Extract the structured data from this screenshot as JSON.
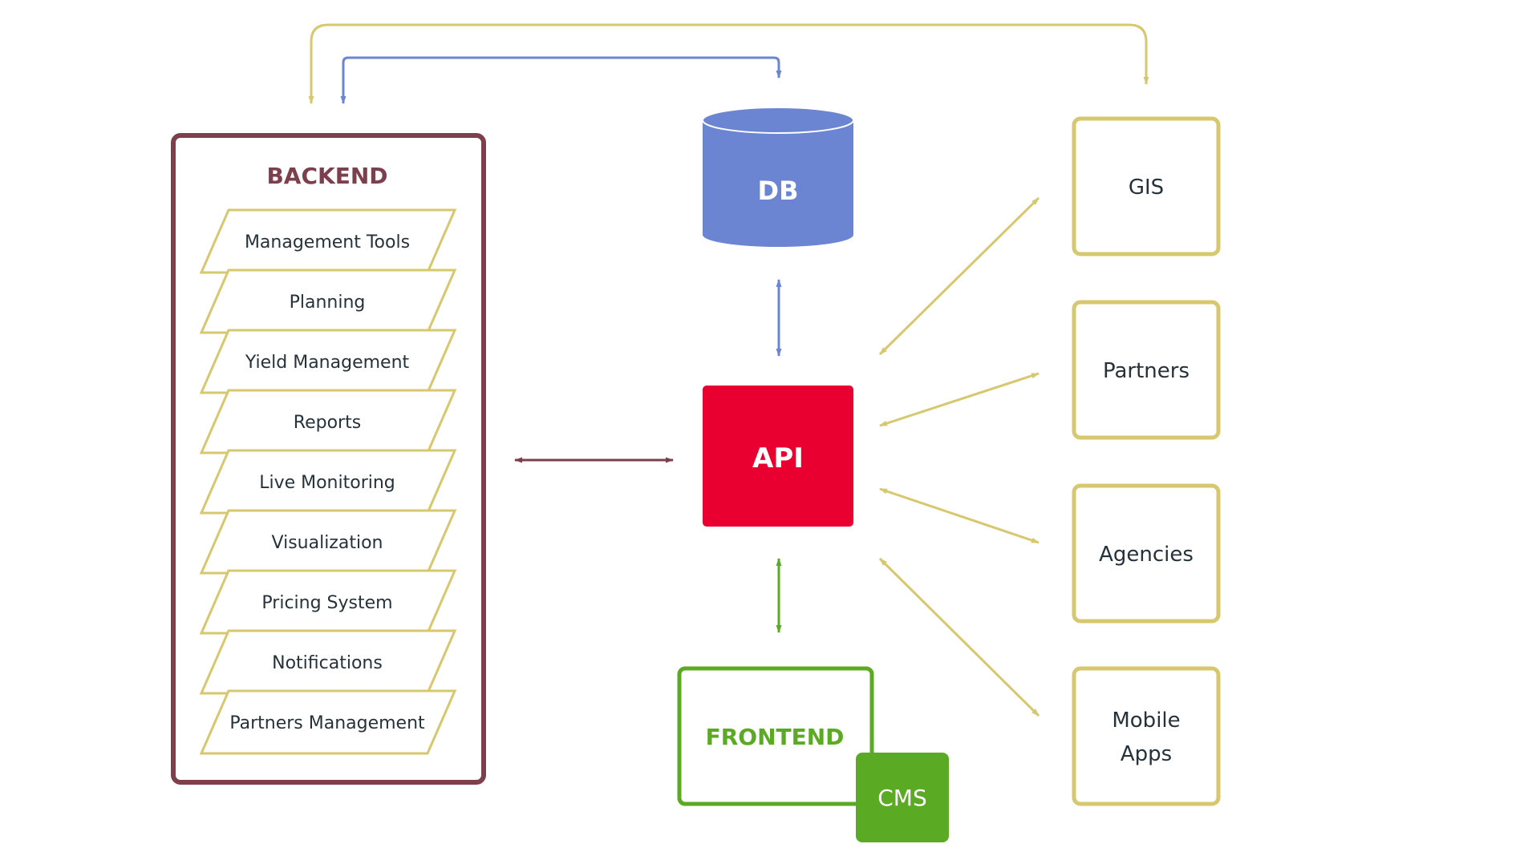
{
  "colors": {
    "backend": "#7e3f4d",
    "yellow": "#d7c76e",
    "blue": "#6b85d3",
    "api": "#ea0030",
    "green": "#5aab23",
    "text_dark": "#26323a",
    "white": "#ffffff"
  },
  "backend": {
    "title": "BACKEND",
    "modules": [
      "Management Tools",
      "Planning",
      "Yield Management",
      "Reports",
      "Live Monitoring",
      "Visualization",
      "Pricing System",
      "Notifications",
      "Partners Management"
    ]
  },
  "db": {
    "label": "DB"
  },
  "api": {
    "label": "API"
  },
  "frontend": {
    "label": "FRONTEND",
    "cms_label": "CMS"
  },
  "external": [
    {
      "id": "gis",
      "lines": [
        "GIS"
      ]
    },
    {
      "id": "partners",
      "lines": [
        "Partners"
      ]
    },
    {
      "id": "agencies",
      "lines": [
        "Agencies"
      ]
    },
    {
      "id": "mobile-apps",
      "lines": [
        "Mobile",
        "Apps"
      ]
    }
  ],
  "connections": [
    {
      "from": "backend",
      "to": "api",
      "direction": "bidirectional",
      "color": "backend"
    },
    {
      "from": "db",
      "to": "api",
      "direction": "bidirectional",
      "color": "blue"
    },
    {
      "from": "api",
      "to": "frontend",
      "direction": "bidirectional",
      "color": "green"
    },
    {
      "from": "db",
      "to": "backend",
      "direction": "bidirectional",
      "color": "blue"
    },
    {
      "from": "gis",
      "to": "backend",
      "direction": "bidirectional",
      "color": "yellow"
    },
    {
      "from": "api",
      "to": "gis",
      "direction": "bidirectional",
      "color": "yellow"
    },
    {
      "from": "api",
      "to": "partners",
      "direction": "bidirectional",
      "color": "yellow"
    },
    {
      "from": "api",
      "to": "agencies",
      "direction": "bidirectional",
      "color": "yellow"
    },
    {
      "from": "api",
      "to": "mobile-apps",
      "direction": "bidirectional",
      "color": "yellow"
    }
  ]
}
